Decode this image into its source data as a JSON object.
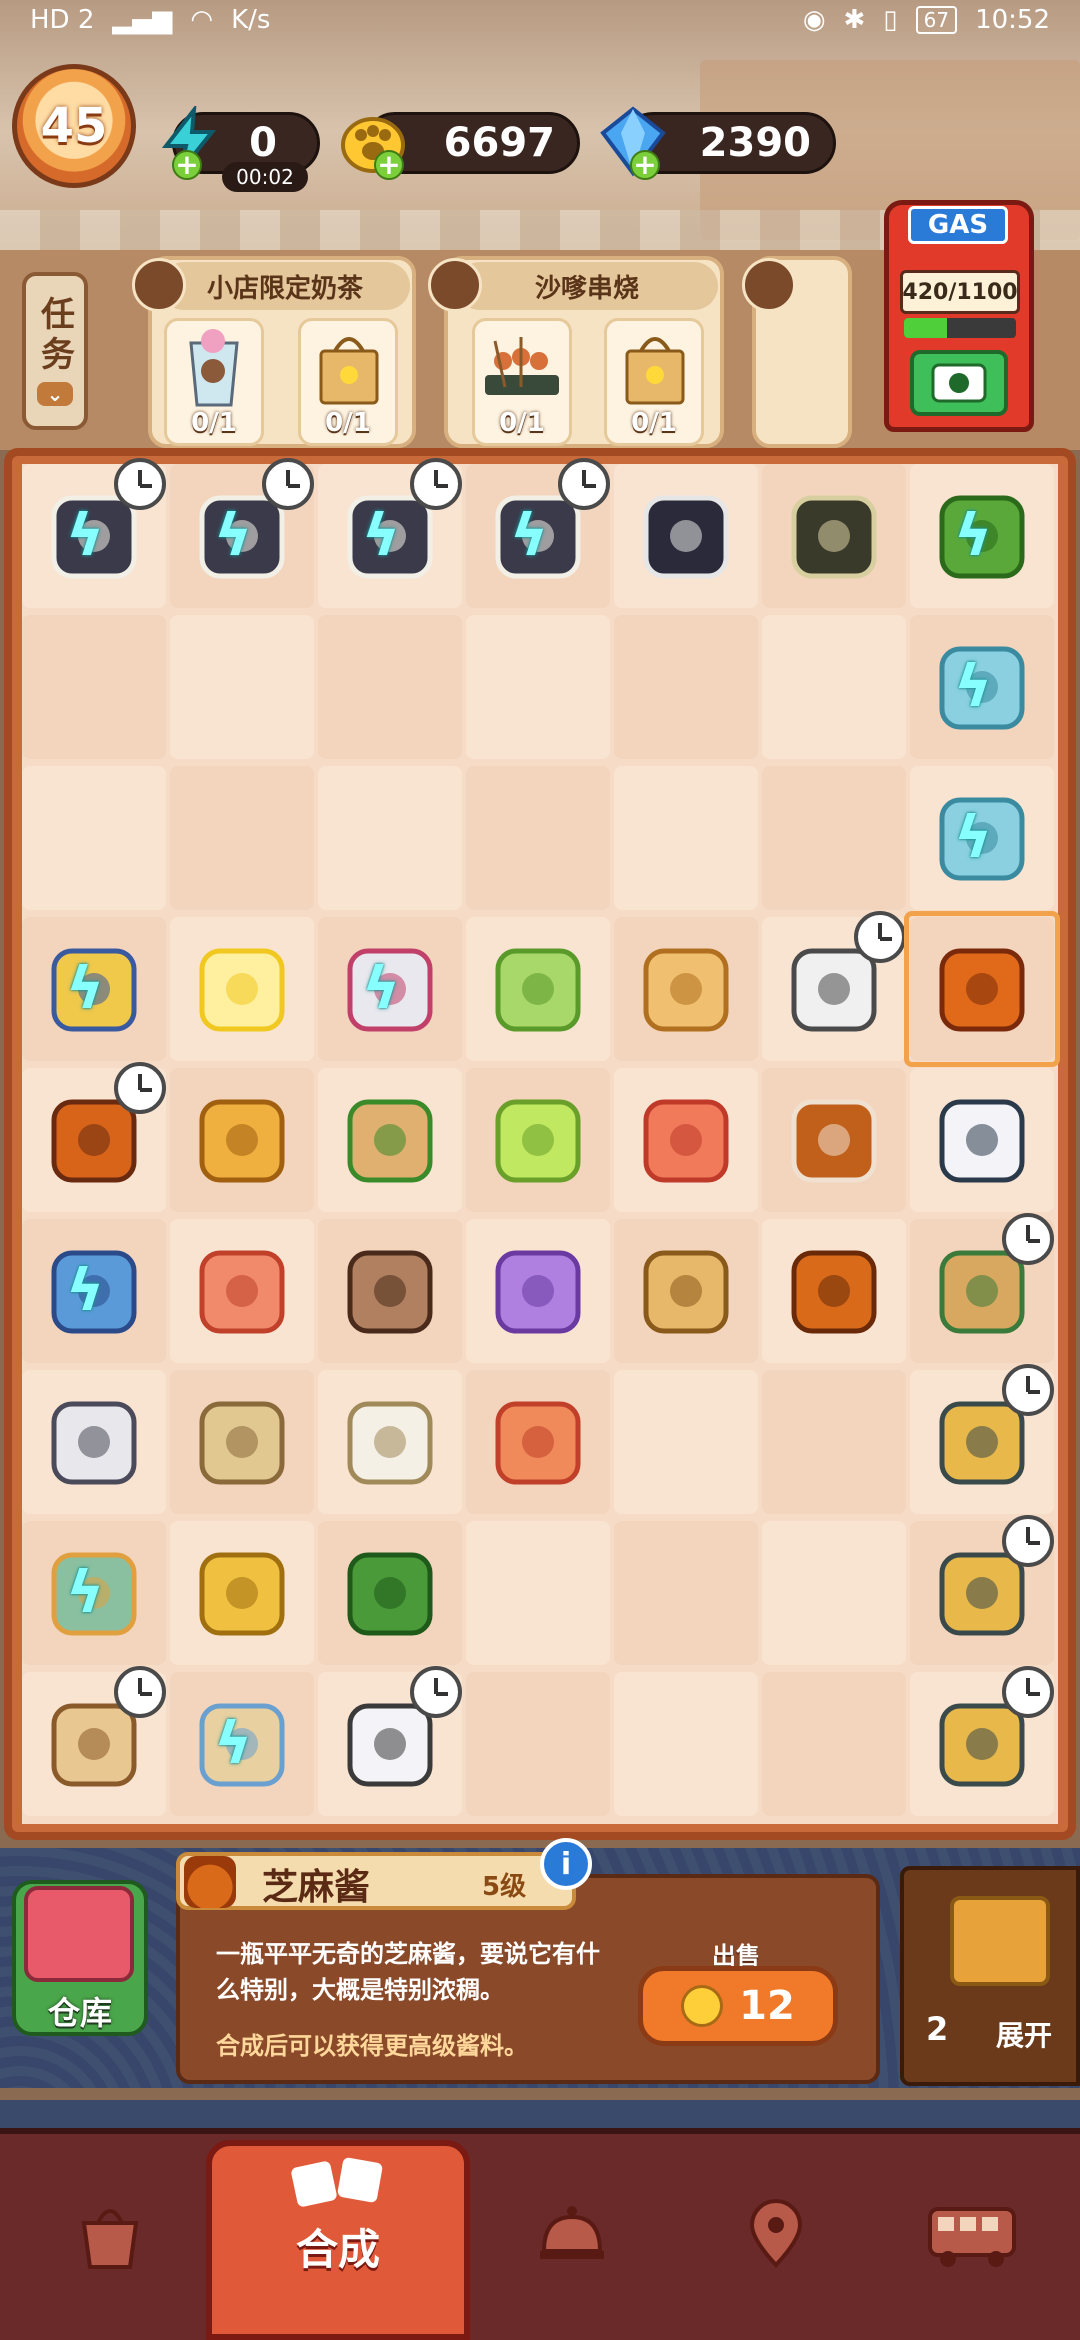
{
  "status_bar": {
    "left_text": "HD 2",
    "speed": "K/s",
    "battery": "67",
    "time": "10:52"
  },
  "hud": {
    "level": "45",
    "energy": "0",
    "energy_timer": "00:02",
    "coins": "6697",
    "gems": "2390"
  },
  "tasks": {
    "button_label": "任务",
    "orders": [
      {
        "title": "小店限定奶茶",
        "items": [
          {
            "icon": "milk-tea-cup-icon",
            "count": "0/1"
          },
          {
            "icon": "paper-bag-icon",
            "count": "0/1"
          }
        ]
      },
      {
        "title": "沙嗲串烧",
        "items": [
          {
            "icon": "skewers-icon",
            "count": "0/1"
          },
          {
            "icon": "paper-bag-icon",
            "count": "0/1"
          }
        ]
      }
    ]
  },
  "gas": {
    "label": "GAS",
    "meter": "420/1100",
    "fill_fraction": 0.38
  },
  "board": {
    "rows": [
      [
        "sushi-roll-generator-icon",
        "sushi-roll-generator-icon",
        "sushi-roll-generator-icon",
        "sushi-roll-generator-icon",
        "seaweed-roll-icon",
        "sugarcane-icon",
        "tree-generator-icon"
      ],
      [
        "",
        "",
        "",
        "",
        "",
        "",
        "fridge-generator-icon"
      ],
      [
        "",
        "",
        "",
        "",
        "",
        "",
        "fridge-generator-icon"
      ],
      [
        "bread-bag-generator-icon",
        "lemon-juice-icon",
        "can-generator-icon",
        "cabbage-icon",
        "bun-icon",
        "printer-icon",
        "sesame-sauce-jar-icon"
      ],
      [
        "barrel-generator-icon",
        "paw-cookies-icon",
        "herbs-board-icon",
        "green-drink-icon",
        "star-candy-icon",
        "iced-tea-glass-icon",
        "milk-bottle-icon"
      ],
      [
        "book-generator-icon",
        "triangle-candy-icon",
        "bubble-tea-icon",
        "taro-drink-icon",
        "paper-bag-icon",
        "sauce-bottle-icon",
        "cart-generator-icon"
      ],
      [
        "machine-generator-icon",
        "beans-pile-icon",
        "rice-pile-icon",
        "diamond-candy-icon",
        "",
        "",
        "drone-generator-icon"
      ],
      [
        "steamer-generator-icon",
        "butter-bars-icon",
        "broccoli-icon",
        "",
        "",
        "",
        "drone-generator-icon"
      ],
      [
        "shelf-generator-icon",
        "water-rack-icon",
        "salt-jar-icon",
        "",
        "",
        "",
        "drone-generator-icon"
      ]
    ]
  },
  "info": {
    "storage_label": "仓库",
    "item_name": "芝麻酱",
    "item_level": "5级",
    "description": "一瓶平平无奇的芝麻酱，要说它有什么特别，大概是特别浓稠。",
    "hint": "合成后可以获得更高级酱料。",
    "sell_label": "出售",
    "sell_price": "12",
    "info_icon": "i",
    "expand_count": "2",
    "expand_label": "展开"
  },
  "nav": {
    "active_label": "合成",
    "tabs": [
      "shop-bag-icon",
      "merge-tab",
      "restaurant-bell-icon",
      "map-pin-icon",
      "bus-icon"
    ]
  },
  "colors": {
    "board_frame": "#c86a3a",
    "accent_orange": "#f07a2a",
    "gas_red": "#e23a2a",
    "bolt_cyan": "#88ffff"
  }
}
